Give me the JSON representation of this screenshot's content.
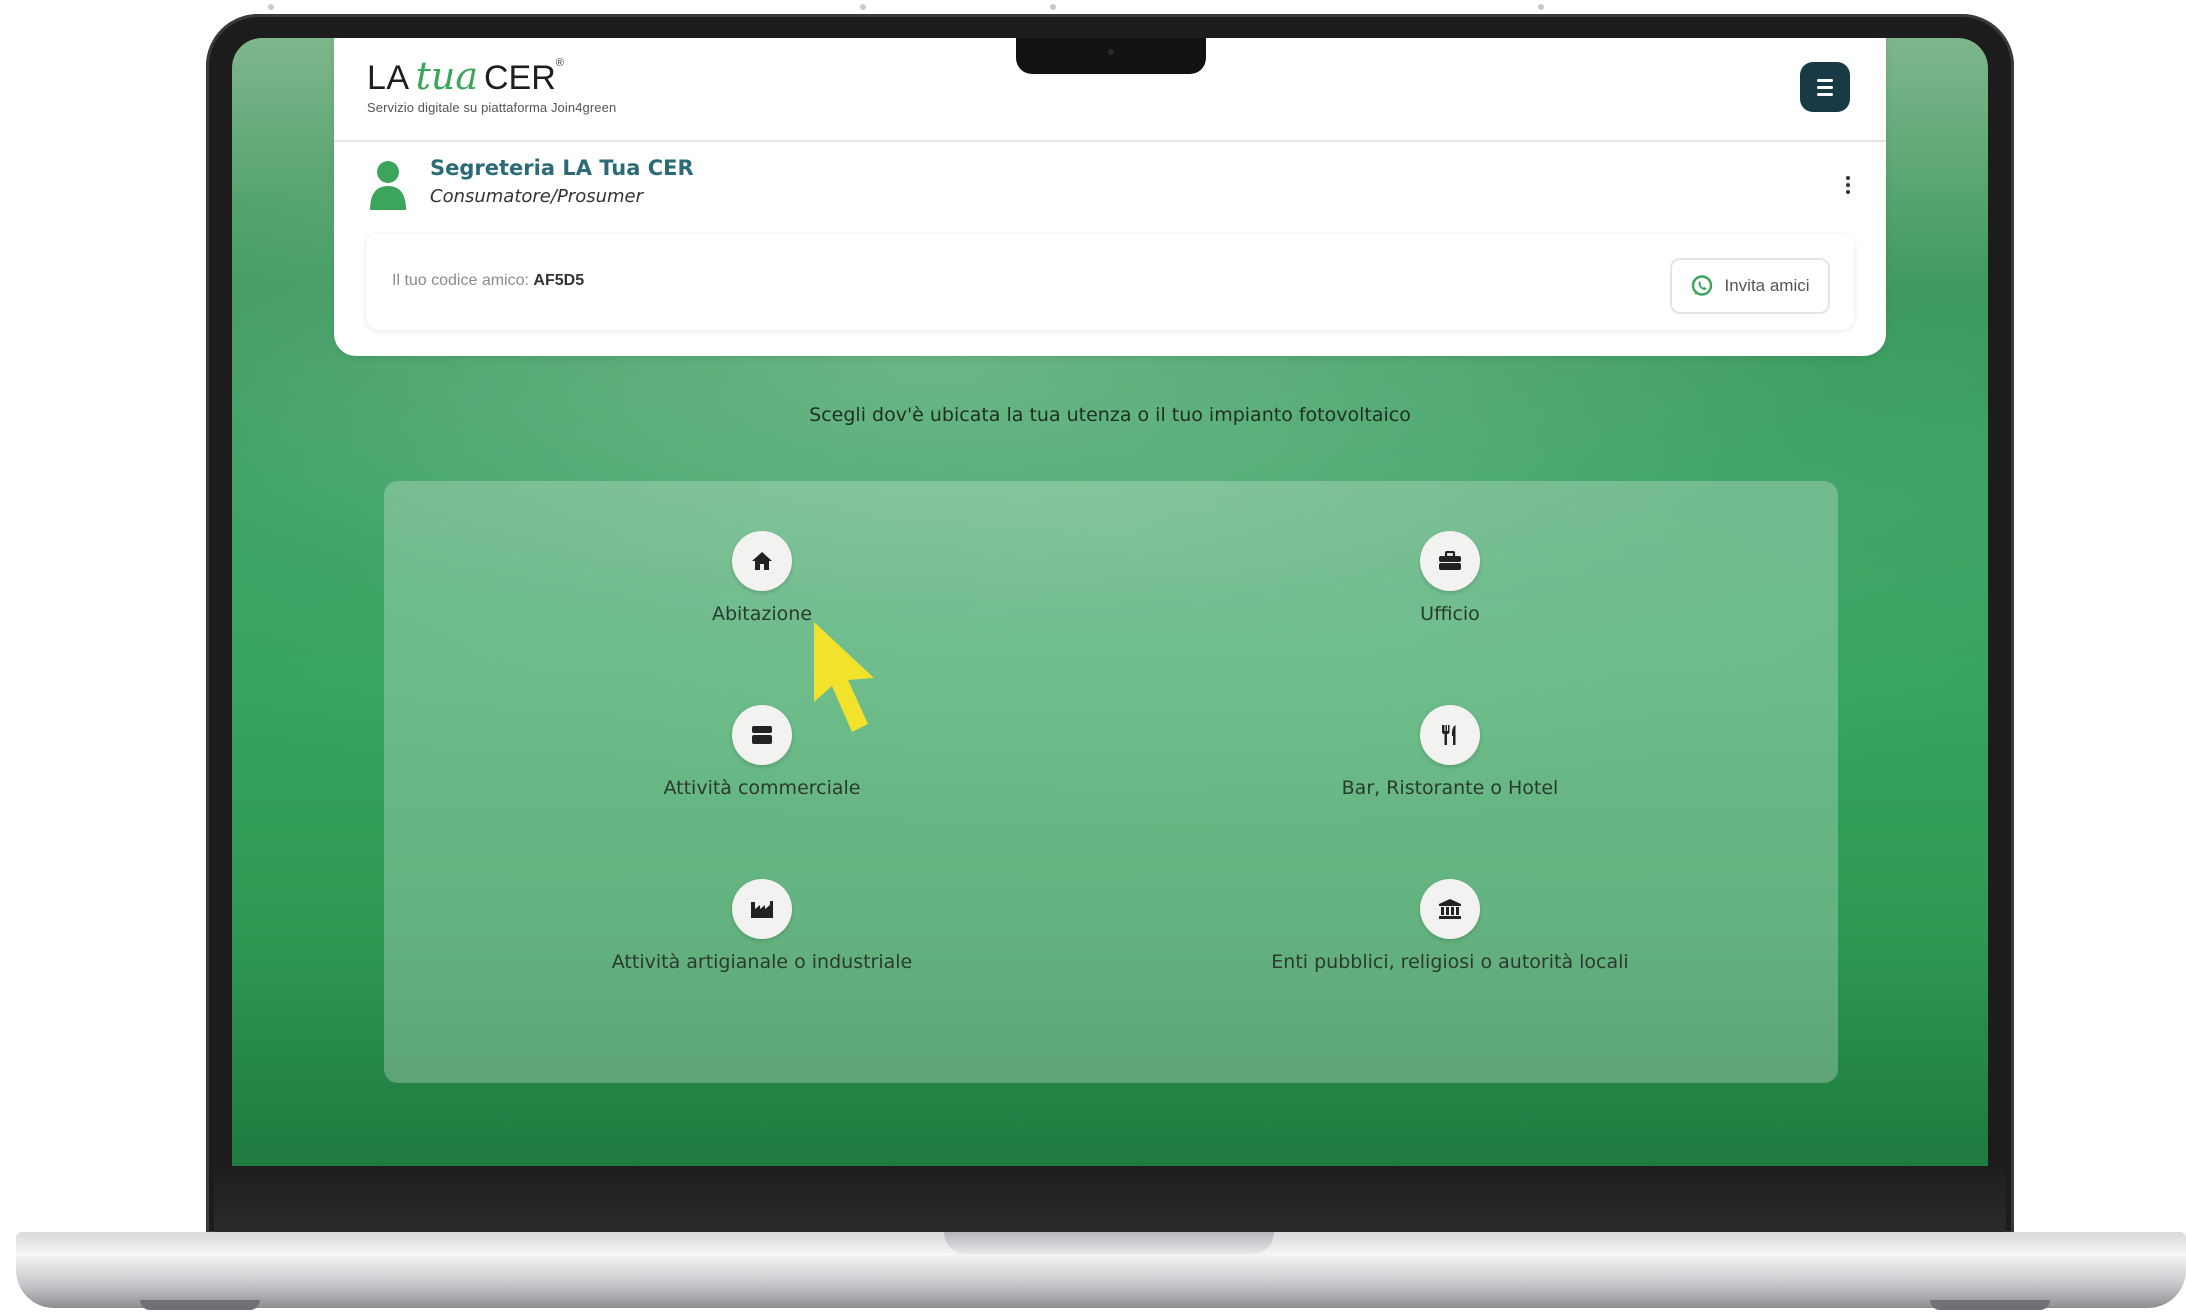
{
  "app": {
    "logo": {
      "la": "LA",
      "tua": "tua",
      "cer": "CER",
      "reg": "®",
      "subtitle": "Servizio digitale su piattaforma Join4green"
    }
  },
  "user": {
    "name": "Segreteria LA Tua CER",
    "role": "Consumatore/Prosumer"
  },
  "referral": {
    "label": "Il tuo codice amico:",
    "code": "AF5D5",
    "invite_label": "Invita amici"
  },
  "instruction": "Scegli dov'è ubicata la tua utenza o il tuo impianto fotovoltaico",
  "options": [
    {
      "label": "Abitazione",
      "icon": "home-icon"
    },
    {
      "label": "Ufficio",
      "icon": "briefcase-icon"
    },
    {
      "label": "Attività commerciale",
      "icon": "store-icon"
    },
    {
      "label": "Bar, Ristorante o Hotel",
      "icon": "utensils-icon"
    },
    {
      "label": "Attività artigianale o industriale",
      "icon": "industry-icon"
    },
    {
      "label": "Enti pubblici, religiosi o autorità locali",
      "icon": "landmark-icon"
    }
  ],
  "colors": {
    "brand_green": "#3aa55b",
    "menu_button": "#173a45",
    "user_name": "#2b6b77",
    "cursor": "#f3e22c"
  }
}
